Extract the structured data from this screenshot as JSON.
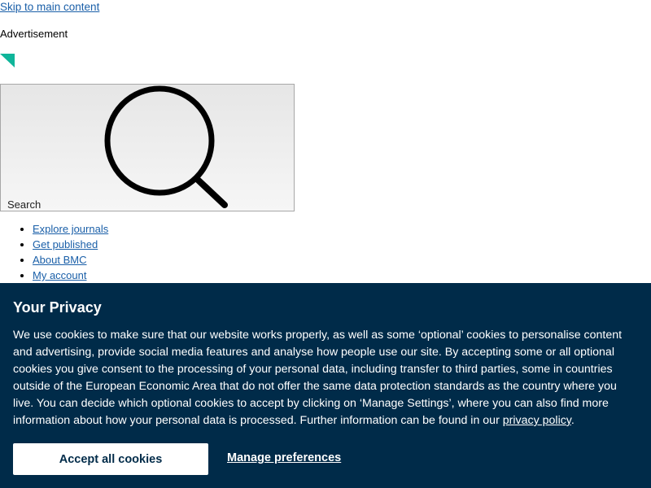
{
  "skip_link": {
    "label": "Skip to main content"
  },
  "advertisement": {
    "label": "Advertisement",
    "marker_color": "#0fb59a"
  },
  "search": {
    "label": "Search",
    "icon": "search-icon"
  },
  "nav": {
    "items": [
      {
        "label": "Explore journals"
      },
      {
        "label": "Get published"
      },
      {
        "label": "About BMC"
      },
      {
        "label": "My account"
      }
    ]
  },
  "cookie_banner": {
    "title": "Your Privacy",
    "body_text": "We use cookies to make sure that our website works properly, as well as some ‘optional’ cookies to personalise content and advertising, provide social media features and analyse how people use our site. By accepting some or all optional cookies you give consent to the processing of your personal data, including transfer to third parties, some in countries outside of the European Economic Area that do not offer the same data protection standards as the country where you live. You can decide which optional cookies to accept by clicking on ‘Manage Settings’, where you can also find more information about how your personal data is processed. Further information can be found in our ",
    "privacy_link": "privacy policy",
    "body_end": ".",
    "accept_label": "Accept all cookies",
    "manage_label": "Manage preferences",
    "background_color": "#002b49"
  }
}
